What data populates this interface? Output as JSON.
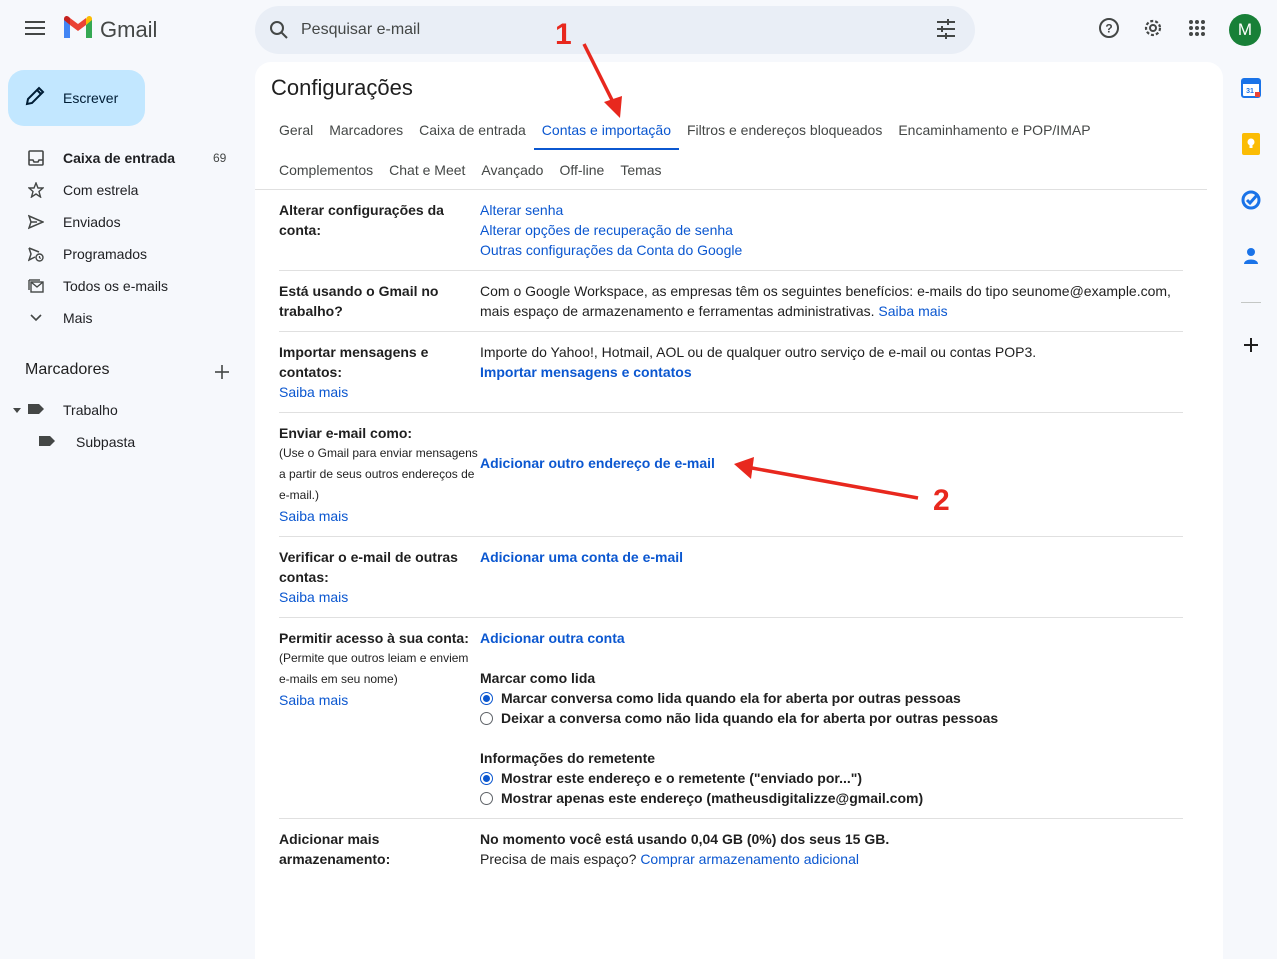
{
  "app": {
    "name": "Gmail"
  },
  "search": {
    "placeholder": "Pesquisar e-mail"
  },
  "account": {
    "initial": "M",
    "color": "#188038"
  },
  "compose": {
    "label": "Escrever"
  },
  "nav": {
    "items": [
      {
        "label": "Caixa de entrada",
        "count": "69",
        "icon": "inbox-icon"
      },
      {
        "label": "Com estrela",
        "icon": "star-icon"
      },
      {
        "label": "Enviados",
        "icon": "send-icon"
      },
      {
        "label": "Programados",
        "icon": "scheduled-icon"
      },
      {
        "label": "Todos os e-mails",
        "icon": "all-mail-icon"
      },
      {
        "label": "Mais",
        "icon": "chevron-down-icon"
      }
    ]
  },
  "labels": {
    "header": "Marcadores",
    "items": [
      {
        "label": "Trabalho"
      },
      {
        "label": "Subpasta"
      }
    ]
  },
  "settings": {
    "title": "Configurações",
    "tabs_row1": [
      "Geral",
      "Marcadores",
      "Caixa de entrada",
      "Contas e importação",
      "Filtros e endereços bloqueados",
      "Encaminhamento e POP/IMAP"
    ],
    "tabs_row2": [
      "Complementos",
      "Chat e Meet",
      "Avançado",
      "Off-line",
      "Temas"
    ],
    "active_tab": "Contas e importação",
    "sections": {
      "change_account": {
        "label": "Alterar configurações da conta:",
        "links": [
          "Alterar senha",
          "Alterar opções de recuperação de senha",
          "Outras configurações da Conta do Google"
        ]
      },
      "work": {
        "label": "Está usando o Gmail no trabalho?",
        "text": "Com o Google Workspace, as empresas têm os seguintes benefícios: e-mails do tipo seunome@example.com, mais espaço de armazenamento e ferramentas administrativas.",
        "link": "Saiba mais"
      },
      "import": {
        "label": "Importar mensagens e contatos:",
        "learn_more": "Saiba mais",
        "text": "Importe do Yahoo!, Hotmail, AOL ou de qualquer outro serviço de e-mail ou contas POP3.",
        "action": "Importar mensagens e contatos"
      },
      "send_as": {
        "label": "Enviar e-mail como:",
        "sub": "(Use o Gmail para enviar mensagens a partir de seus outros endereços de e-mail.)",
        "learn_more": "Saiba mais",
        "action": "Adicionar outro endereço de e-mail"
      },
      "check_mail": {
        "label": "Verificar o e-mail de outras contas:",
        "learn_more": "Saiba mais",
        "action": "Adicionar uma conta de e-mail"
      },
      "grant_access": {
        "label": "Permitir acesso à sua conta:",
        "sub": "(Permite que outros leiam e enviem e-mails em seu nome)",
        "learn_more": "Saiba mais",
        "action": "Adicionar outra conta",
        "mark_read_title": "Marcar como lida",
        "mark_read_options": [
          {
            "label": "Marcar conversa como lida quando ela for aberta por outras pessoas",
            "checked": true
          },
          {
            "label": "Deixar a conversa como não lida quando ela for aberta por outras pessoas",
            "checked": false
          }
        ],
        "sender_info_title": "Informações do remetente",
        "sender_info_options": [
          {
            "label": "Mostrar este endereço e o remetente (\"enviado por...\")",
            "checked": true
          },
          {
            "label": "Mostrar apenas este endereço (matheusdigitalizze@gmail.com)",
            "checked": false
          }
        ]
      },
      "storage": {
        "label": "Adicionar mais armazenamento:",
        "usage": "No momento você está usando 0,04 GB (0%) dos seus 15 GB.",
        "need_more": "Precisa de mais espaço?",
        "link": "Comprar armazenamento adicional"
      }
    }
  },
  "annotations": {
    "first": "1",
    "second": "2",
    "color": "#e8281e"
  }
}
